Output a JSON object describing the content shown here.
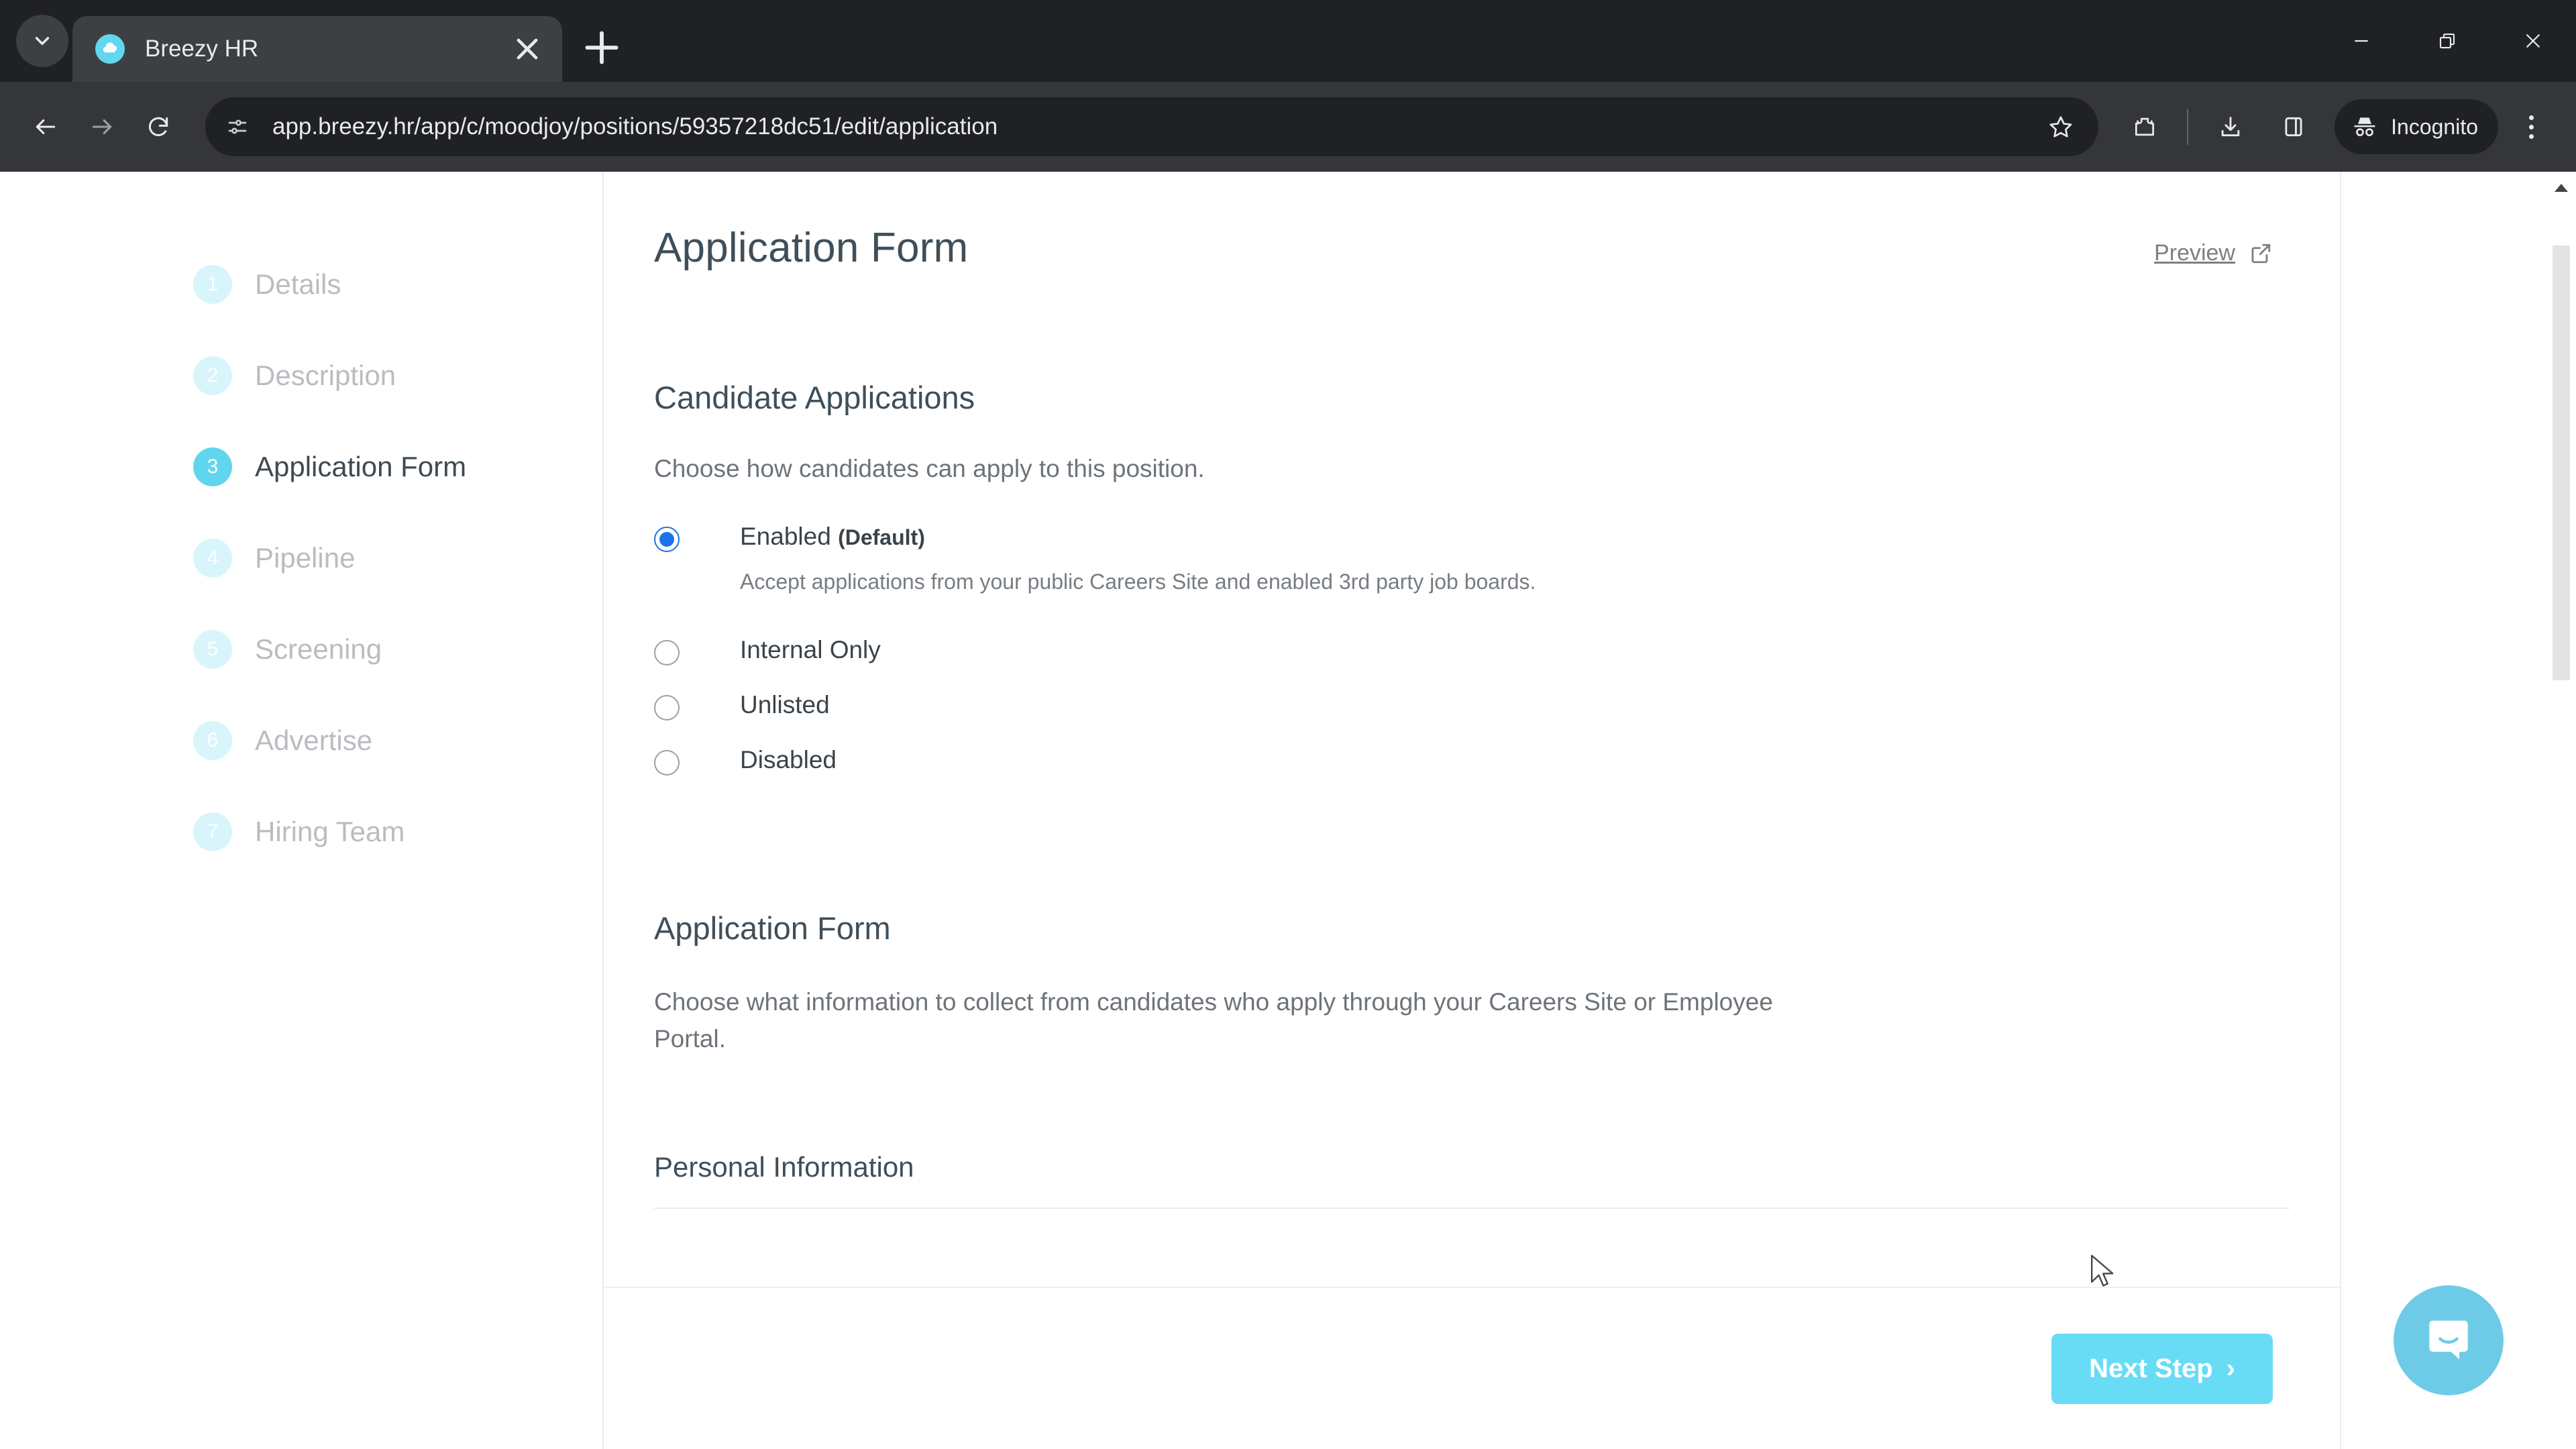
{
  "browser": {
    "tab": {
      "title": "Breezy HR",
      "favicon_icon": "breezy-cloud-icon",
      "close_icon": "close-icon"
    },
    "tab_search_icon": "chevron-down-icon",
    "new_tab_icon": "plus-icon",
    "window_controls": {
      "minimize_icon": "minimize-icon",
      "restore_icon": "restore-icon",
      "close_icon": "close-icon"
    },
    "toolbar": {
      "back_icon": "arrow-left-icon",
      "forward_icon": "arrow-right-icon",
      "reload_icon": "reload-icon",
      "site_info_icon": "site-settings-icon",
      "url": "app.breezy.hr/app/c/moodjoy/positions/59357218dc51/edit/application",
      "bookmark_icon": "star-icon",
      "extensions_icon": "extensions-puzzle-icon",
      "downloads_icon": "download-icon",
      "side_panel_icon": "side-panel-icon",
      "incognito_label": "Incognito",
      "incognito_icon": "incognito-hat-icon",
      "menu_icon": "three-dots-menu-icon"
    }
  },
  "wizard": {
    "steps": [
      {
        "num": "1",
        "label": "Details",
        "active": false
      },
      {
        "num": "2",
        "label": "Description",
        "active": false
      },
      {
        "num": "3",
        "label": "Application Form",
        "active": true
      },
      {
        "num": "4",
        "label": "Pipeline",
        "active": false
      },
      {
        "num": "5",
        "label": "Screening",
        "active": false
      },
      {
        "num": "6",
        "label": "Advertise",
        "active": false
      },
      {
        "num": "7",
        "label": "Hiring Team",
        "active": false
      }
    ]
  },
  "main": {
    "page_title": "Application Form",
    "preview": {
      "label": "Preview",
      "icon": "external-link-icon"
    },
    "candidate_applications": {
      "title": "Candidate Applications",
      "description": "Choose how candidates can apply to this position.",
      "options": [
        {
          "label": "Enabled",
          "badge": "(Default)",
          "sub": "Accept applications from your public Careers Site and enabled 3rd party job boards.",
          "checked": true
        },
        {
          "label": "Internal Only",
          "badge": "",
          "sub": "",
          "checked": false
        },
        {
          "label": "Unlisted",
          "badge": "",
          "sub": "",
          "checked": false
        },
        {
          "label": "Disabled",
          "badge": "",
          "sub": "",
          "checked": false
        }
      ]
    },
    "application_form": {
      "title": "Application Form",
      "description": "Choose what information to collect from candidates who apply through your Careers Site or Employee Portal.",
      "subsection_title": "Personal Information"
    },
    "footer": {
      "next_label": "Next Step",
      "next_chevron": "›"
    }
  },
  "widgets": {
    "intercom_icon": "intercom-chat-icon"
  },
  "colors": {
    "accent": "#62d5ee",
    "accent_button": "#69dcf5",
    "step_inactive": "#d8f5fc",
    "radio_selected": "#1a73e8",
    "title_text": "#3f4f5a",
    "body_text": "#6d737a",
    "chrome_tabstrip": "#202124",
    "chrome_toolbar": "#35363a",
    "intercom": "#6dcbe7"
  }
}
